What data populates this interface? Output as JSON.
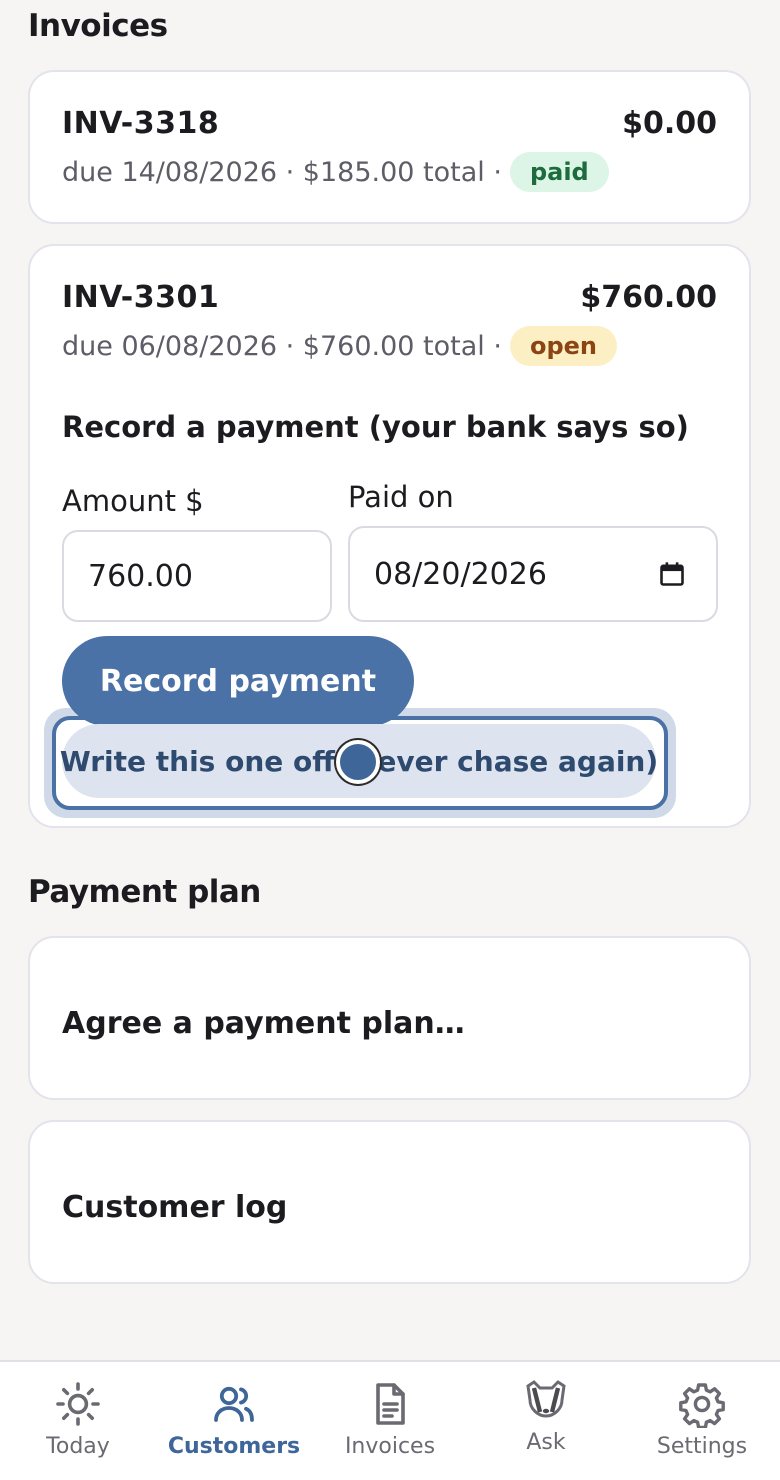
{
  "invoices": {
    "title": "Invoices",
    "items": [
      {
        "id": "INV-3318",
        "amount": "$0.00",
        "meta": "due 14/08/2026 · $185.00 total ·",
        "status": "paid"
      },
      {
        "id": "INV-3301",
        "amount": "$760.00",
        "meta": "due 06/08/2026 · $760.00 total ·",
        "status": "open"
      }
    ]
  },
  "record_payment": {
    "heading": "Record a payment (your bank says so)",
    "amount_label": "Amount $",
    "amount_value": "760.00",
    "date_label": "Paid on",
    "date_value": "08/20/2026",
    "record_button": "Record payment",
    "write_off_button": "Write this one off (never chase again)"
  },
  "payment_plan": {
    "title": "Payment plan",
    "agree_label": "Agree a payment plan…",
    "log_label": "Customer log"
  },
  "nav": {
    "items": [
      {
        "label": "Today",
        "icon": "sun-icon"
      },
      {
        "label": "Customers",
        "icon": "users-icon",
        "active": true
      },
      {
        "label": "Invoices",
        "icon": "document-icon"
      },
      {
        "label": "Ask",
        "icon": "badger-icon"
      },
      {
        "label": "Settings",
        "icon": "gear-icon"
      }
    ]
  },
  "colors": {
    "accent": "#4b72a6",
    "paid_bg": "#dcf5e6",
    "open_bg": "#fcefc4"
  }
}
